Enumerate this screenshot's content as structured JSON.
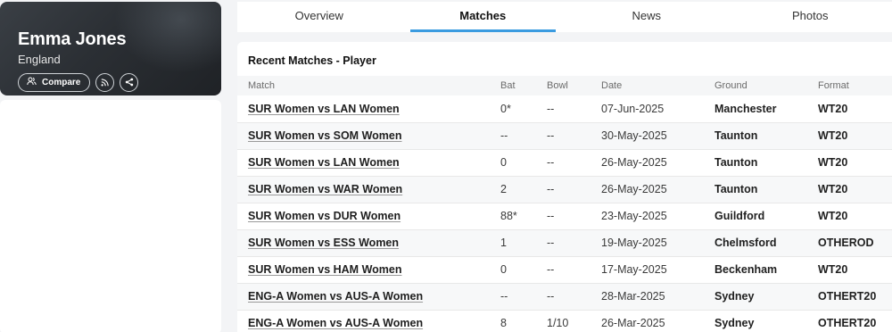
{
  "player": {
    "name": "Emma Jones",
    "country": "England",
    "compare_label": "Compare"
  },
  "tabs": [
    {
      "label": "Overview",
      "active": false
    },
    {
      "label": "Matches",
      "active": true
    },
    {
      "label": "News",
      "active": false
    },
    {
      "label": "Photos",
      "active": false
    }
  ],
  "matches": {
    "title": "Recent Matches - Player",
    "columns": [
      "Match",
      "Bat",
      "Bowl",
      "Date",
      "Ground",
      "Format"
    ],
    "rows": [
      {
        "match": "SUR Women vs LAN Women",
        "bat": "0*",
        "bowl": "--",
        "date": "07-Jun-2025",
        "ground": "Manchester",
        "format": "WT20"
      },
      {
        "match": "SUR Women vs SOM Women",
        "bat": "--",
        "bowl": "--",
        "date": "30-May-2025",
        "ground": "Taunton",
        "format": "WT20"
      },
      {
        "match": "SUR Women vs LAN Women",
        "bat": "0",
        "bowl": "--",
        "date": "26-May-2025",
        "ground": "Taunton",
        "format": "WT20"
      },
      {
        "match": "SUR Women vs WAR Women",
        "bat": "2",
        "bowl": "--",
        "date": "26-May-2025",
        "ground": "Taunton",
        "format": "WT20"
      },
      {
        "match": "SUR Women vs DUR Women",
        "bat": "88*",
        "bowl": "--",
        "date": "23-May-2025",
        "ground": "Guildford",
        "format": "WT20"
      },
      {
        "match": "SUR Women vs ESS Women",
        "bat": "1",
        "bowl": "--",
        "date": "19-May-2025",
        "ground": "Chelmsford",
        "format": "OTHEROD"
      },
      {
        "match": "SUR Women vs HAM Women",
        "bat": "0",
        "bowl": "--",
        "date": "17-May-2025",
        "ground": "Beckenham",
        "format": "WT20"
      },
      {
        "match": "ENG-A Women vs AUS-A Women",
        "bat": "--",
        "bowl": "--",
        "date": "28-Mar-2025",
        "ground": "Sydney",
        "format": "OTHERT20"
      },
      {
        "match": "ENG-A Women vs AUS-A Women",
        "bat": "8",
        "bowl": "1/10",
        "date": "26-Mar-2025",
        "ground": "Sydney",
        "format": "OTHERT20"
      }
    ]
  },
  "icons": {
    "compare": "users-icon",
    "rss": "rss-icon",
    "share": "share-icon"
  }
}
